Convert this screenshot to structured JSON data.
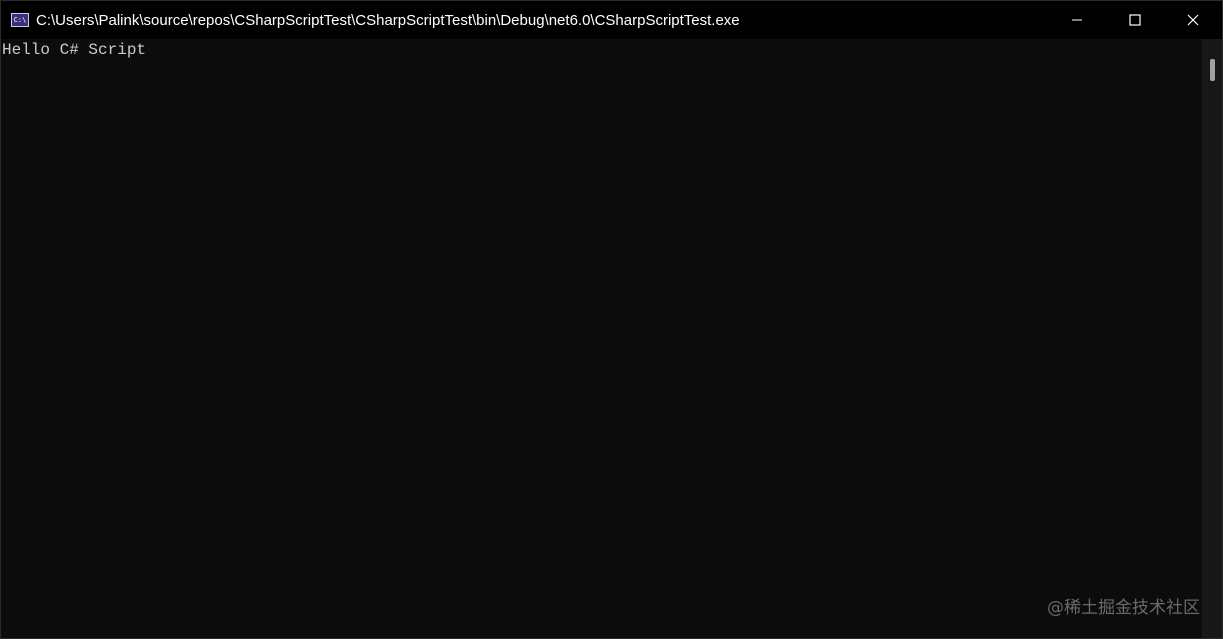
{
  "window": {
    "title": "C:\\Users\\Palink\\source\\repos\\CSharpScriptTest\\CSharpScriptTest\\bin\\Debug\\net6.0\\CSharpScriptTest.exe",
    "icon_label": "C:\\",
    "icon": "console-app-icon"
  },
  "controls": {
    "minimize_icon": "minimize-icon",
    "maximize_icon": "maximize-icon",
    "close_icon": "close-icon"
  },
  "console": {
    "lines": [
      "Hello C# Script"
    ],
    "background": "#0c0c0c",
    "foreground": "#cccccc"
  },
  "watermark": {
    "text": "@稀土掘金技术社区"
  }
}
